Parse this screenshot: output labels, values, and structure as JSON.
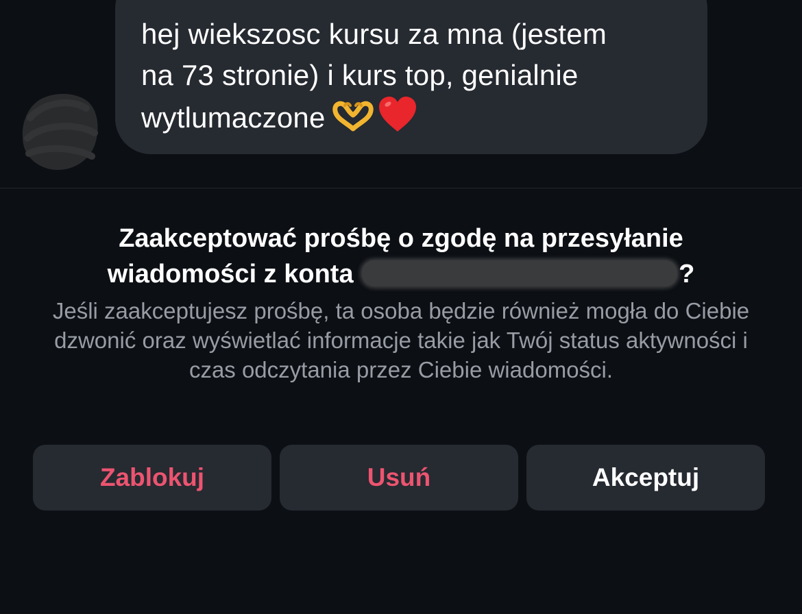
{
  "message": {
    "text": "hej wiekszosc kursu za mna (jestem na 73 stronie) i kurs top, genialnie wytlumaczone",
    "line1": "hej wiekszosc kursu za mna (jestem",
    "line2": "na 73 stronie) i kurs top, genialnie",
    "line3": "wytlumaczone",
    "emojis": [
      "heart-hands-emoji",
      "red-heart-emoji"
    ]
  },
  "request": {
    "title_part1": "Zaakceptować prośbę o zgodę na przesyłanie",
    "title_part2": "wiadomości z konta",
    "title_part3": "?",
    "body": "Jeśli zaakceptujesz prośbę, ta osoba będzie również mogła do Ciebie dzwonić oraz wyświetlać informacje takie jak Twój status aktywności i czas odczytania przez Ciebie wiadomości."
  },
  "actions": {
    "block_label": "Zablokuj",
    "delete_label": "Usuń",
    "accept_label": "Akceptuj"
  },
  "colors": {
    "background": "#0c0f14",
    "bubble": "#262a31",
    "destructive": "#ec5470",
    "secondary_text": "#989ca4"
  }
}
